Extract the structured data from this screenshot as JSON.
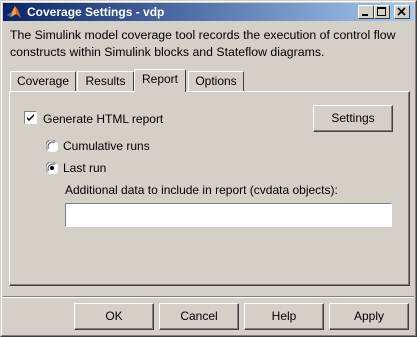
{
  "window": {
    "title": "Coverage Settings - vdp",
    "app_icon": "matlab-icon",
    "controls": {
      "minimize": "minimize-icon",
      "maximize": "maximize-icon",
      "close": "close-icon"
    }
  },
  "description": "The Simulink model coverage tool records the execution of control flow constructs within Simulink blocks and Stateflow diagrams.",
  "tabs": [
    {
      "label": "Coverage",
      "active": false
    },
    {
      "label": "Results",
      "active": false
    },
    {
      "label": "Report",
      "active": true
    },
    {
      "label": "Options",
      "active": false
    }
  ],
  "report": {
    "generate_html_label": "Generate HTML report",
    "generate_html_checked": true,
    "settings_button": "Settings",
    "radio_cumulative": "Cumulative runs",
    "radio_last_run": "Last run",
    "selected_radio": "Last run",
    "cvdata_label": "Additional data to include in report (cvdata objects):",
    "cvdata_value": ""
  },
  "buttons": {
    "ok": "OK",
    "cancel": "Cancel",
    "help": "Help",
    "apply": "Apply"
  }
}
